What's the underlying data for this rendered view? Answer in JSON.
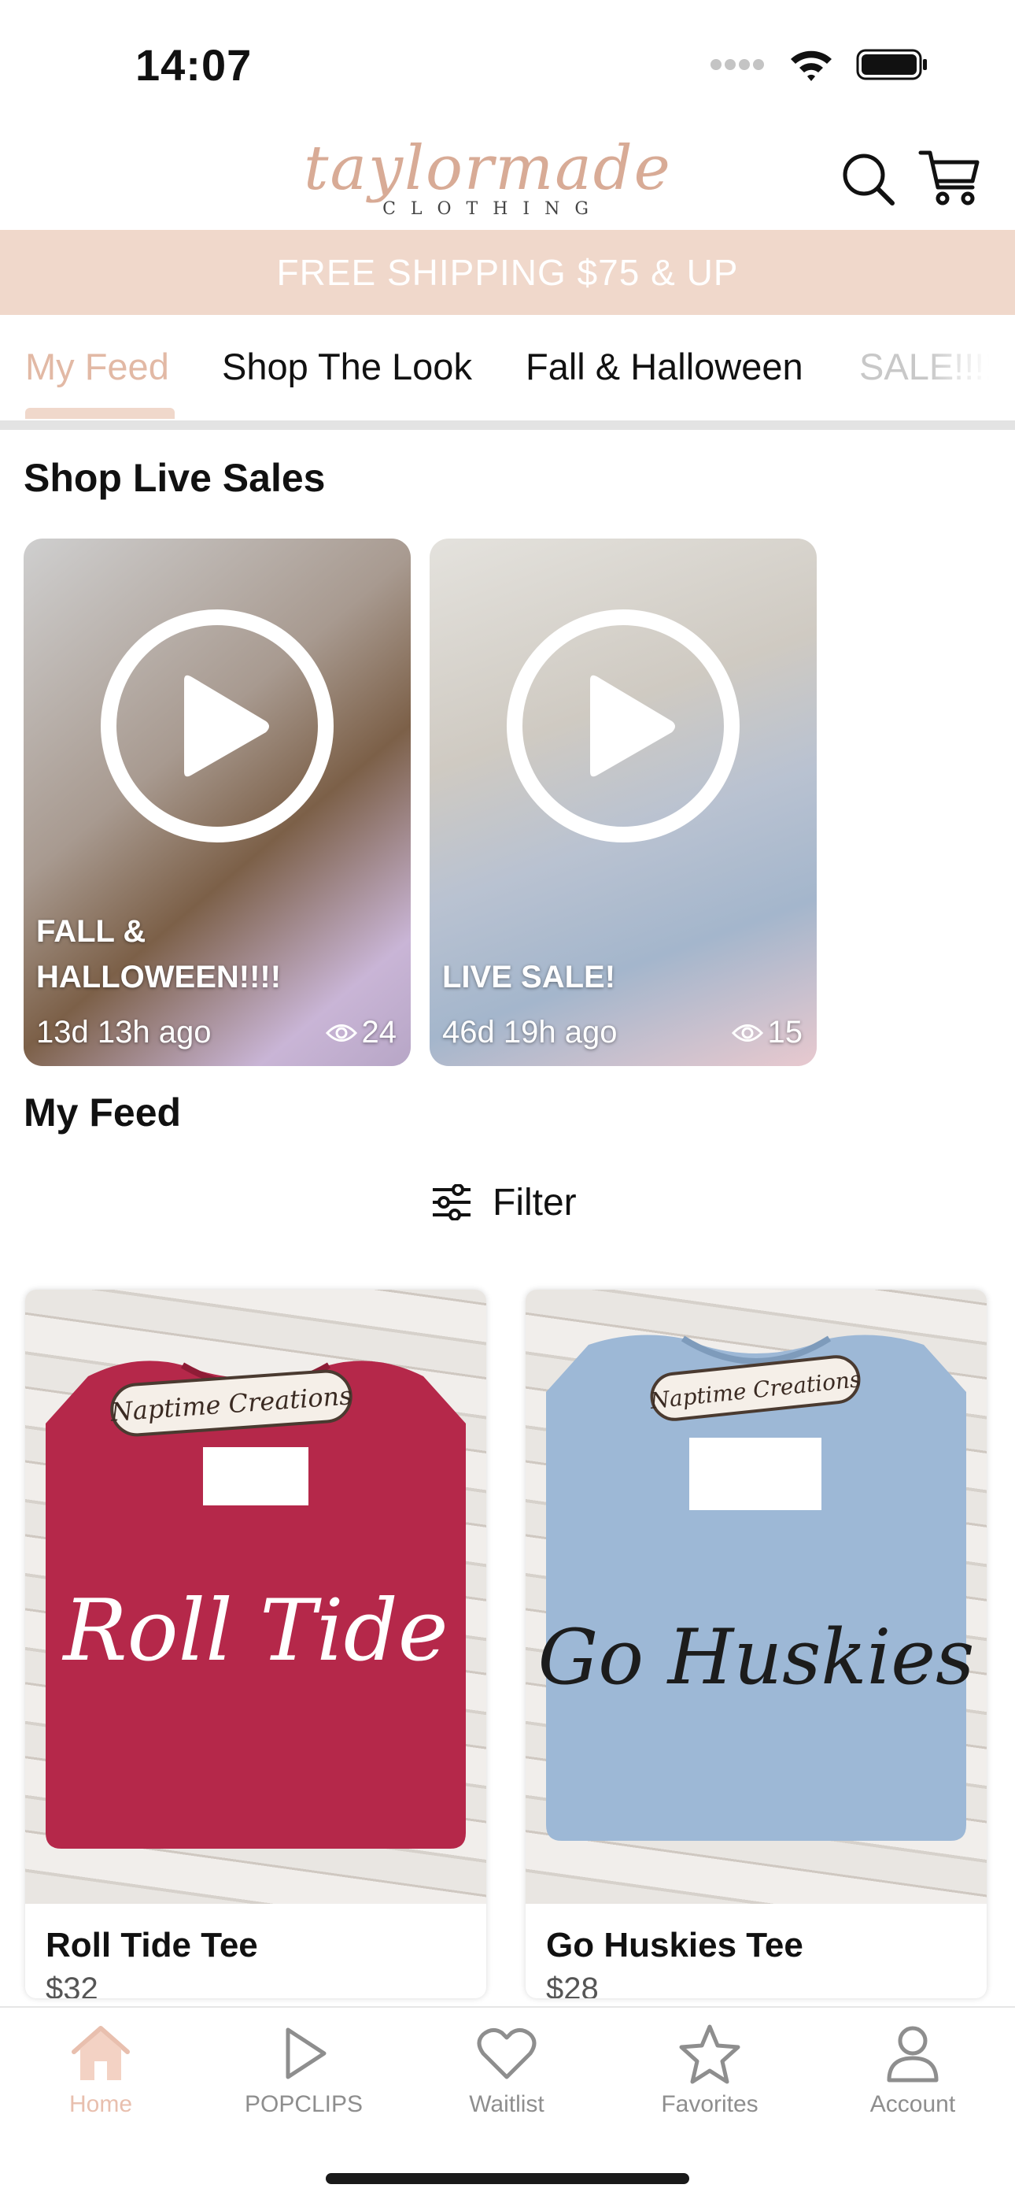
{
  "status_bar": {
    "time": "14:07"
  },
  "header": {
    "logo_script": "taylormade",
    "logo_sub": "C L O T H I N G",
    "banner": "FREE SHIPPING $75 & UP"
  },
  "tabs": [
    {
      "label": "My Feed",
      "active": true
    },
    {
      "label": "Shop The Look"
    },
    {
      "label": "Fall & Halloween"
    },
    {
      "label": "SALE!!!!"
    }
  ],
  "live_sales": {
    "title": "Shop Live Sales",
    "items": [
      {
        "title": "FALL & HALLOWEEN!!!!",
        "ago": "13d 13h ago",
        "views": "24"
      },
      {
        "title": "LIVE SALE!",
        "ago": "46d 19h ago",
        "views": "15"
      }
    ]
  },
  "feed": {
    "title": "My Feed",
    "filter_label": "Filter",
    "products": [
      {
        "name": "Roll Tide Tee",
        "price": "$32",
        "shirt_color": "#b5284a",
        "print_text": "Roll Tide",
        "print_color": "#ffffff",
        "tag_text": "Naptime Creations"
      },
      {
        "name": "Go Huskies Tee",
        "price": "$28",
        "shirt_color": "#9db8d6",
        "print_text": "Go Huskies",
        "print_color": "#1c1c1c",
        "tag_text": "Naptime Creations"
      }
    ]
  },
  "bottom_nav": [
    {
      "label": "Home",
      "icon": "home-icon",
      "active": true
    },
    {
      "label": "POPCLIPS",
      "icon": "play-icon"
    },
    {
      "label": "Waitlist",
      "icon": "heart-icon"
    },
    {
      "label": "Favorites",
      "icon": "star-icon"
    },
    {
      "label": "Account",
      "icon": "person-icon"
    }
  ],
  "colors": {
    "accent": "#e2b9a5",
    "banner_bg": "#f0d8cb",
    "logo": "#d8ab96"
  }
}
